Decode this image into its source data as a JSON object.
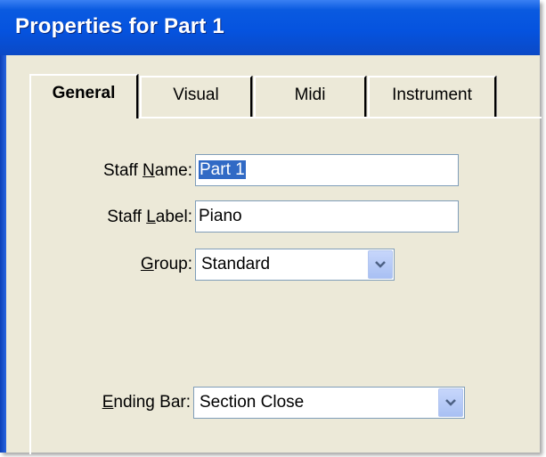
{
  "window": {
    "title": "Properties for Part 1"
  },
  "tabs": [
    {
      "label": "General",
      "active": true
    },
    {
      "label": "Visual",
      "active": false
    },
    {
      "label": "Midi",
      "active": false
    },
    {
      "label": "Instrument",
      "active": false
    }
  ],
  "form": {
    "staff_name": {
      "label_pre": "Staff ",
      "label_key": "N",
      "label_post": "ame:",
      "value": "Part 1"
    },
    "staff_label": {
      "label_pre": "Staff ",
      "label_key": "L",
      "label_post": "abel:",
      "value": "Piano"
    },
    "group": {
      "label_pre": "",
      "label_key": "G",
      "label_post": "roup:",
      "value": "Standard"
    },
    "ending_bar": {
      "label_pre": "",
      "label_key": "E",
      "label_post": "nding Bar:",
      "value": "Section Close"
    }
  },
  "colors": {
    "title_bar": "#0553df",
    "dialog_bg": "#ece9d8",
    "selection": "#316ac5"
  },
  "icons": {
    "combo_arrow": "chevron-down-icon"
  }
}
